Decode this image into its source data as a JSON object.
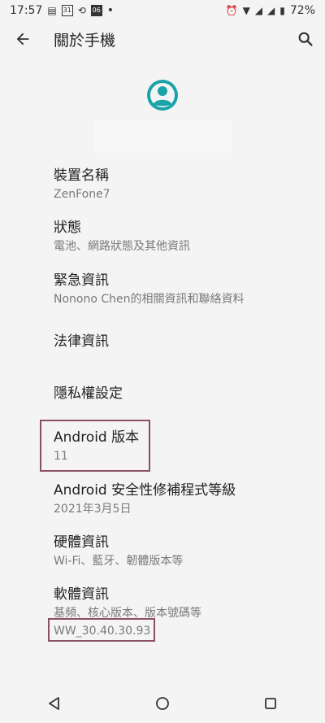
{
  "status_bar": {
    "time": "17:57",
    "calendar_day": "31",
    "box_label": "06",
    "dot": "•",
    "battery": "72%"
  },
  "app_bar": {
    "title": "關於手機"
  },
  "icons": {
    "back": "arrow-back-icon",
    "search": "search-icon",
    "avatar": "account-circle-icon",
    "nav_back": "triangle-back-icon",
    "nav_home": "circle-home-icon",
    "nav_recents": "square-recents-icon"
  },
  "items": [
    {
      "title": "裝置名稱",
      "subtitle": "ZenFone7"
    },
    {
      "title": "狀態",
      "subtitle": "電池、網路狀態及其他資訊"
    },
    {
      "title": "緊急資訊",
      "subtitle": "Nonono Chen的相關資訊和聯絡資料"
    },
    {
      "title": "法律資訊",
      "subtitle": ""
    },
    {
      "title": "隱私權設定",
      "subtitle": ""
    },
    {
      "title": "Android 版本",
      "subtitle": "11"
    },
    {
      "title": "Android 安全性修補程式等級",
      "subtitle": "2021年3月5日"
    },
    {
      "title": "硬體資訊",
      "subtitle": "Wi-Fi、藍牙、韌體版本等"
    },
    {
      "title": "軟體資訊",
      "subtitle": "基頻、核心版本、版本號碼等",
      "build": "WW_30.40.30.93"
    }
  ],
  "colors": {
    "accent": "#1aa3a8",
    "highlight": "#8a4f62"
  }
}
